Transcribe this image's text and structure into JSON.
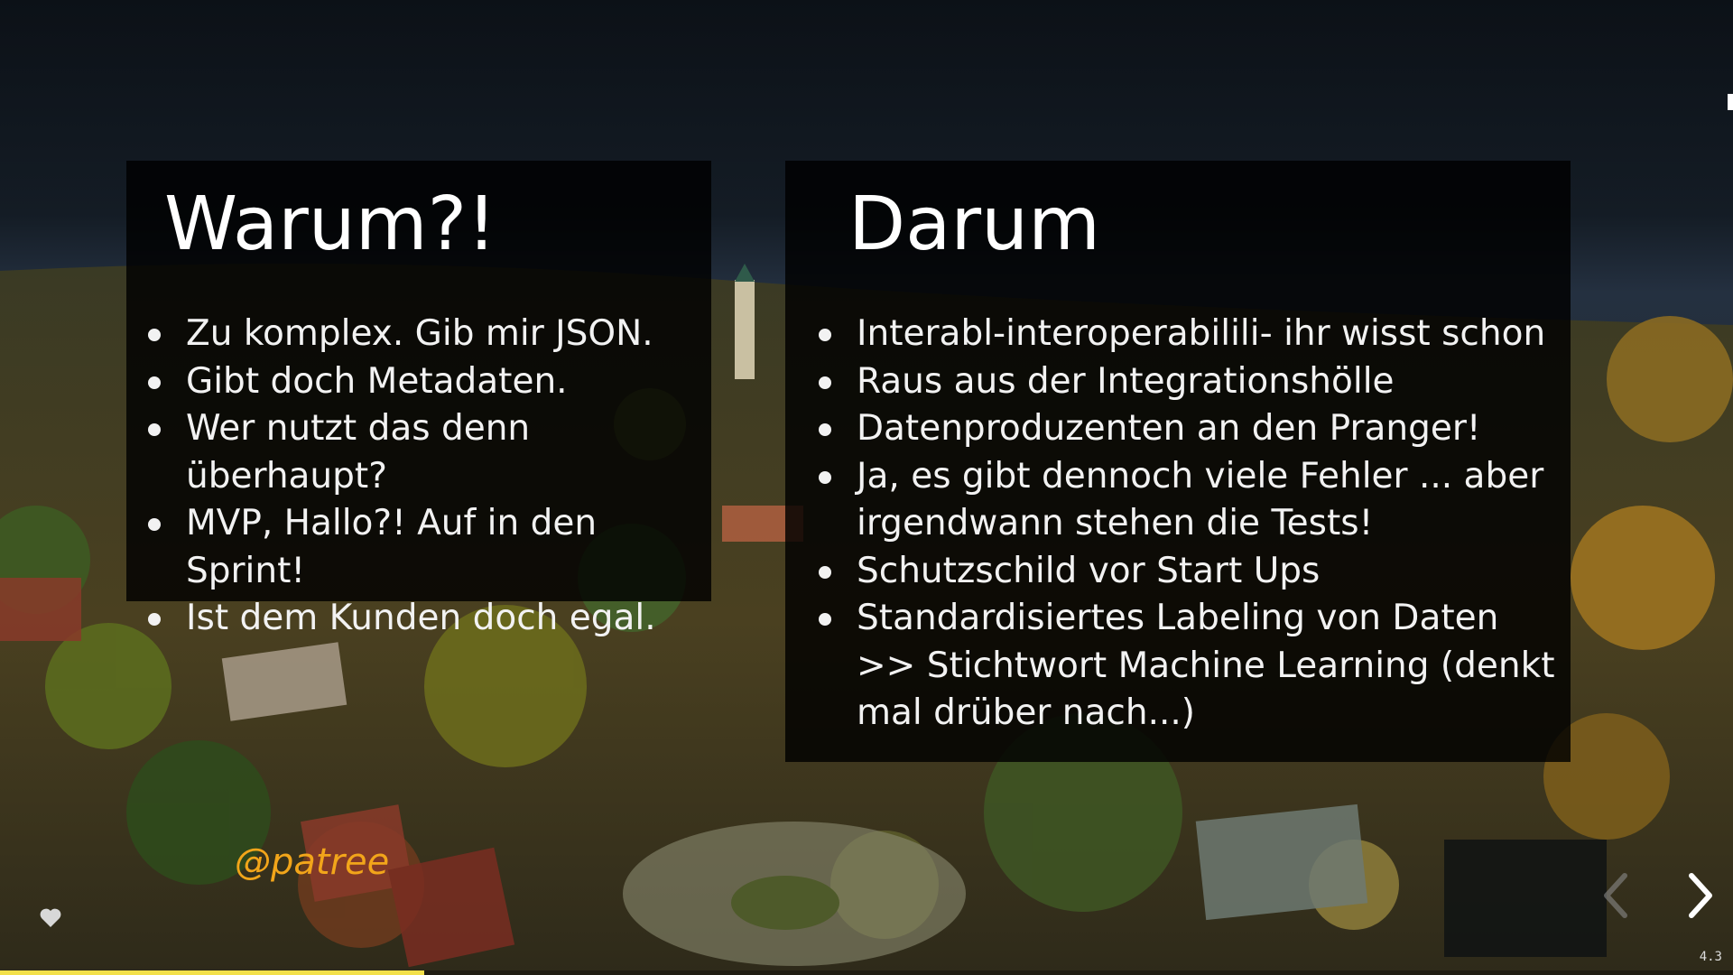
{
  "slide": {
    "left_panel": {
      "title": "Warum?!",
      "items": [
        "Zu komplex. Gib mir JSON.",
        "Gibt doch Metadaten.",
        "Wer nutzt das denn überhaupt?",
        "MVP, Hallo?! Auf in den Sprint!",
        "Ist dem Kunden doch egal."
      ]
    },
    "right_panel": {
      "title": "Darum",
      "items": [
        "Interabl-interoperabilili- ihr wisst schon",
        "Raus aus der Integrationshölle",
        "Datenproduzenten an den Pranger!",
        "Ja, es gibt dennoch viele Fehler ... aber irgendwann stehen die Tests!",
        "Schutzschild vor Start Ups",
        "Standardisiertes Labeling von Daten >> Stichtwort Machine Learning (denkt mal drüber nach...)"
      ]
    },
    "handle": "@patree",
    "slide_number": "4.3"
  },
  "controls": {
    "heart_icon": "heart-icon",
    "prev_icon": "chevron-left-icon",
    "next_icon": "chevron-right-icon",
    "progress": 0.245
  },
  "colors": {
    "handle": "#f2a51a",
    "progress": "#f2e04a",
    "panel_bg": "#000000"
  }
}
